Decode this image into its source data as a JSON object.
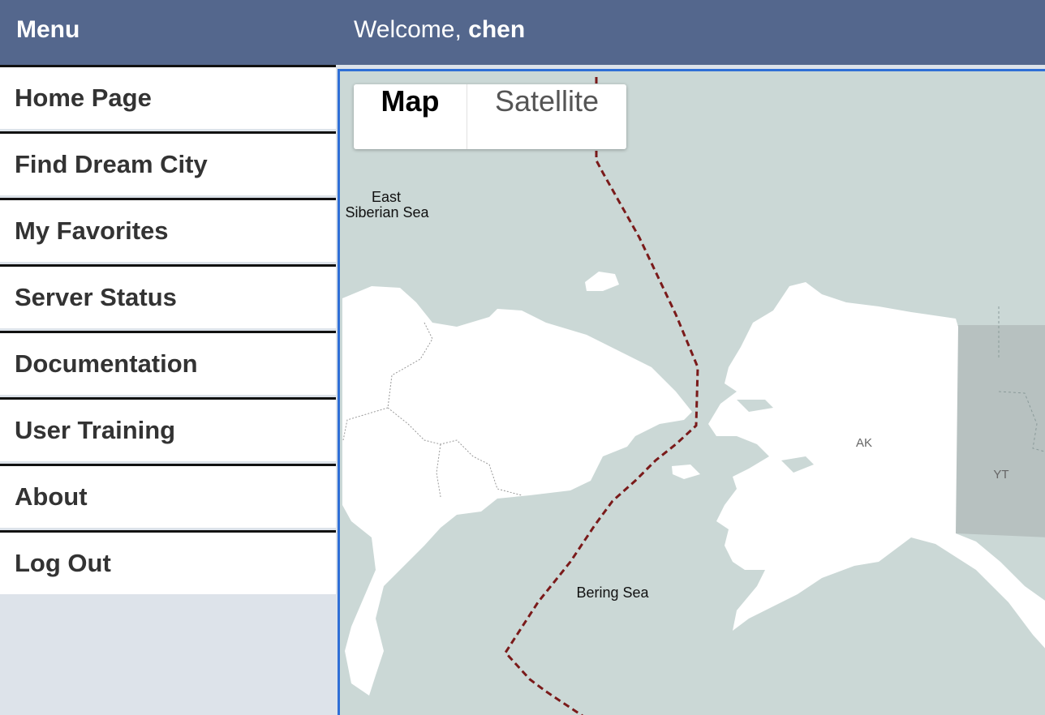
{
  "header": {
    "menu_label": "Menu",
    "welcome_prefix": "Welcome, ",
    "username": "chen"
  },
  "nav": {
    "items": [
      {
        "label": "Home Page"
      },
      {
        "label": "Find Dream City"
      },
      {
        "label": "My Favorites"
      },
      {
        "label": "Server Status"
      },
      {
        "label": "Documentation"
      },
      {
        "label": "User Training"
      },
      {
        "label": "About"
      },
      {
        "label": "Log Out"
      }
    ]
  },
  "map": {
    "type_buttons": {
      "map": "Map",
      "satellite": "Satellite",
      "selected": "map"
    },
    "labels": {
      "east_siberian_line1": "East",
      "east_siberian_line2": "Siberian Sea",
      "bering_sea": "Bering Sea",
      "ak": "AK",
      "yt": "YT"
    },
    "colors": {
      "water": "#cbd8d6",
      "land": "#ffffff",
      "canada": "#b7c1c0",
      "boundary": "#7a1a1a"
    }
  }
}
